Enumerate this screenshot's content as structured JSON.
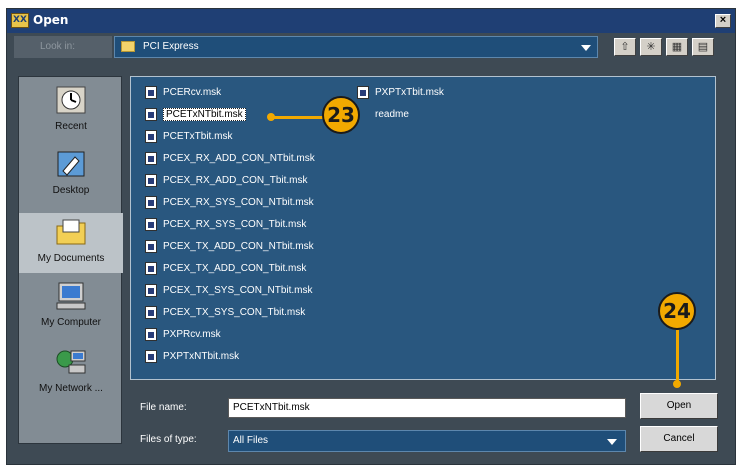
{
  "window": {
    "title": "Open",
    "close_symbol": "×"
  },
  "lookin": {
    "label": "Look in:",
    "value": "PCI Express"
  },
  "toolbar": [
    {
      "name": "up-folder-icon",
      "glyph": "⇧"
    },
    {
      "name": "new-folder-icon",
      "glyph": "✳"
    },
    {
      "name": "list-view-icon",
      "glyph": "▦"
    },
    {
      "name": "details-view-icon",
      "glyph": "▤"
    }
  ],
  "places": [
    {
      "label": "Recent",
      "icon": "recent-icon"
    },
    {
      "label": "Desktop",
      "icon": "desktop-icon"
    },
    {
      "label": "My Documents",
      "icon": "my-documents-icon"
    },
    {
      "label": "My Computer",
      "icon": "my-computer-icon"
    },
    {
      "label": "My Network ...",
      "icon": "network-icon"
    }
  ],
  "files_col1": [
    "PCERcv.msk",
    "PCETxNTbit.msk",
    "PCETxTbit.msk",
    "PCEX_RX_ADD_CON_NTbit.msk",
    "PCEX_RX_ADD_CON_Tbit.msk",
    "PCEX_RX_SYS_CON_NTbit.msk",
    "PCEX_RX_SYS_CON_Tbit.msk",
    "PCEX_TX_ADD_CON_NTbit.msk",
    "PCEX_TX_ADD_CON_Tbit.msk",
    "PCEX_TX_SYS_CON_NTbit.msk",
    "PCEX_TX_SYS_CON_Tbit.msk",
    "PXPRcv.msk",
    "PXPTxNTbit.msk"
  ],
  "files_col2": [
    "PXPTxTbit.msk",
    "readme"
  ],
  "selected_file": "PCETxNTbit.msk",
  "filename": {
    "label": "File name:",
    "value": "PCETxNTbit.msk"
  },
  "filetype": {
    "label": "Files of type:",
    "value": "All Files"
  },
  "buttons": {
    "open": "Open",
    "cancel": "Cancel"
  },
  "callouts": {
    "step1": "23",
    "step2": "24"
  },
  "colors": {
    "callout": "#f2a900",
    "list_bg": "#29577f",
    "dialog_bg": "#3e4a54"
  }
}
